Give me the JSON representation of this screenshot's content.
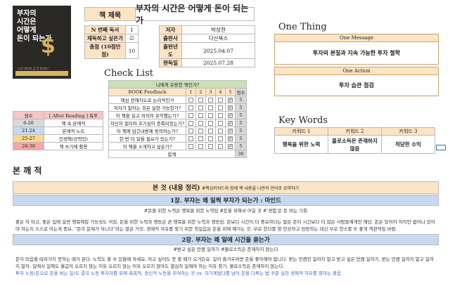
{
  "book": {
    "cover_title": [
      "부자의",
      "시간은",
      "어떻게",
      "돈이 되는가"
    ],
    "cover_subtitle": "\"시간 관리가 곧 돈 관리다\"",
    "title_label": "책 제목",
    "title": "부자의 시간은 어떻게 돈이 되는가"
  },
  "info_left": [
    {
      "label": "N 번째 독서",
      "value": "1"
    },
    {
      "label": "재독하고 싶은가",
      "value": "☑"
    },
    {
      "label": "총점 (10점만점)",
      "value": "10"
    }
  ],
  "info_right": [
    {
      "label": "저자",
      "value": "박성현"
    },
    {
      "label": "출판사",
      "value": "다산북스"
    },
    {
      "label": "출판년도",
      "value": "2025.04.07"
    },
    {
      "label": "완독일",
      "value": "2025.07.28"
    }
  ],
  "one_thing": {
    "heading": "One Thing",
    "message_label": "One Message",
    "message": "투자의 본질과 지속 가능한 투자 철학",
    "action_label": "One Action",
    "action": "투자 습관 점검"
  },
  "check_list": {
    "heading": "Check List",
    "question": "나에게 유용한 책인가?",
    "feedback_label": "BOOK Feedback",
    "scale": [
      "1",
      "2",
      "3",
      "4",
      "5"
    ],
    "score_label": "점수",
    "items": [
      {
        "q": "핵심 전해지도로 논리적인가",
        "checked": 5,
        "score": "5"
      },
      {
        "q": "저자가 말하는 것은 실현 가능한가?",
        "checked": 5,
        "score": "5"
      },
      {
        "q": "이 책을 읽고 저자의 유익했는가?",
        "checked": 5,
        "score": "5"
      },
      {
        "q": "자신의 흥미와 호기심이 충족되었는가?",
        "checked": 5,
        "score": "5"
      },
      {
        "q": "이 책에 담긴내용에 동의하는가?",
        "checked": 5,
        "score": "5"
      },
      {
        "q": "한 번 더 읽을 필요가 있는가?",
        "checked": 5,
        "score": "5"
      },
      {
        "q": "이 책을 소개하고 싶은가?",
        "checked": 5,
        "score": "5"
      }
    ],
    "total_label": "합계",
    "total": "30"
  },
  "legend": {
    "score_label": "점수",
    "review_label": "[ After Reading ] 독후",
    "rows": [
      {
        "range": "6-20",
        "text": "책 속 본깨적",
        "color": "#d9d9d9"
      },
      {
        "range": "21-24",
        "text": "본깨적 노트",
        "color": "#c6d9f1"
      },
      {
        "range": "25-27",
        "text": "인생책(강력인)",
        "color": "#fbd68b"
      },
      {
        "range": "28-30",
        "text": "책 쓰기에 활용",
        "color": "#f4a9a8"
      }
    ]
  },
  "key_words": {
    "heading": "Key Words",
    "items": [
      {
        "label": "키워드 1",
        "value": "행복을 위한 노력"
      },
      {
        "label": "키워드 2",
        "value": "불로소득은 존재하지 않음"
      },
      {
        "label": "키워드 3",
        "value": "적당한 수익"
      }
    ]
  },
  "section": {
    "heading": "본 깨 적",
    "summary_label": "본 것 (내용 정리)",
    "summary_hint": "#핵심키워드와 함께 핵 내용을 나만의 언어로 요약하기",
    "ch1_title": "1장. 부자는 왜 일찍 부자가 되는가 : 마인드",
    "ch1_tags": "#돈을 위한 노력은 행복을 위한 노력임 #돈을 위해서 어길 것 #'경험'은 돈 버는 기회",
    "ch1_body": "좋은 차 타고, 좋은 집에 살면 행복해질 가능성도 커짐. 돈을 위한 노력과 행동은 곧 행복을 위한 노력과 행동임. 돈보다 시간이 더 중요하다는 말은 돈이 시간보다 더 많은 사람들에게만 해당. 돈은 있어야 하지만 없어나 있어야 하는지 스스로 아는게 중요. \"돈이 문제가 아니다\"라는 말은 거짓. 경제적 자유를 찾기 위한 첫걸음은 돈을 위해 예가는 것. 부로 한다를 향 안상하고 원망하는 대신 부로 한스를 또 좋게 객관적임 바람.",
    "ch2_title": "2장. 부자는 왜 일에 시간을 쏟는가",
    "ch2_tags": "#받고 싶은 만큼 일하기 #불로소득은 존재하지 않는다",
    "ch2_body": "돈이 미음을 따라가지 못하는 때가 온다. 노력도 할 수 있을때 하세요. 하고 싶어도 못 할 때가 오거든요. 일이 즐거우려면 돈을 좋아해야 합니다. 받는 만큼만 일하지 말고 받고 싶은 만큼 일하기. 받는 만큼 일하지 말고 일하지 말자. 일에서 일해도 월급이 오르지 않는 이유 오르지 않는 이유 오르지 않아도 열심히 일해야 하는 이유 찾기. 불로소득은 존재하지 않는다.",
    "ch2_extra": "투자 노동(돈으로 돈을 버는 일)도 결국 노동 투자자를 위해 축복적, 정신적 노동을 부여하는 것 ex. 자기계발다를 넘어 돈을 다루는 법 꾸준 실천 경제적 자유를 향하는 좋음"
  }
}
